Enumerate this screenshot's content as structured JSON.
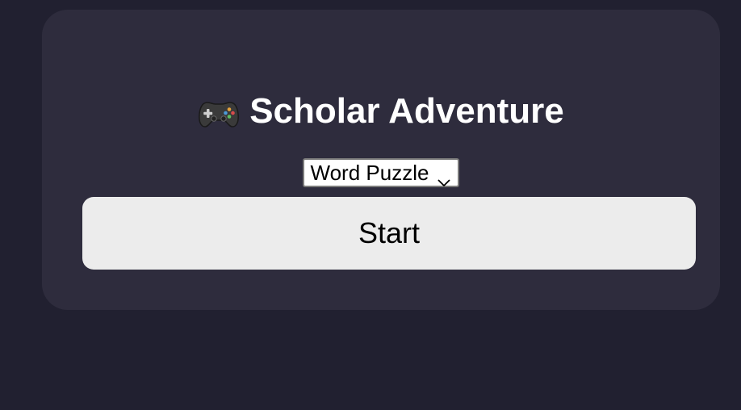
{
  "app": {
    "title": "Scholar Adventure",
    "title_icon": "gamepad-icon"
  },
  "mode_select": {
    "selected": "Word Puzzle",
    "icon": "chevron-down-icon"
  },
  "actions": {
    "start_label": "Start"
  },
  "colors": {
    "background": "#212030",
    "card": "#2e2c3d",
    "title_text": "#ffffff",
    "button": "#ececec"
  }
}
